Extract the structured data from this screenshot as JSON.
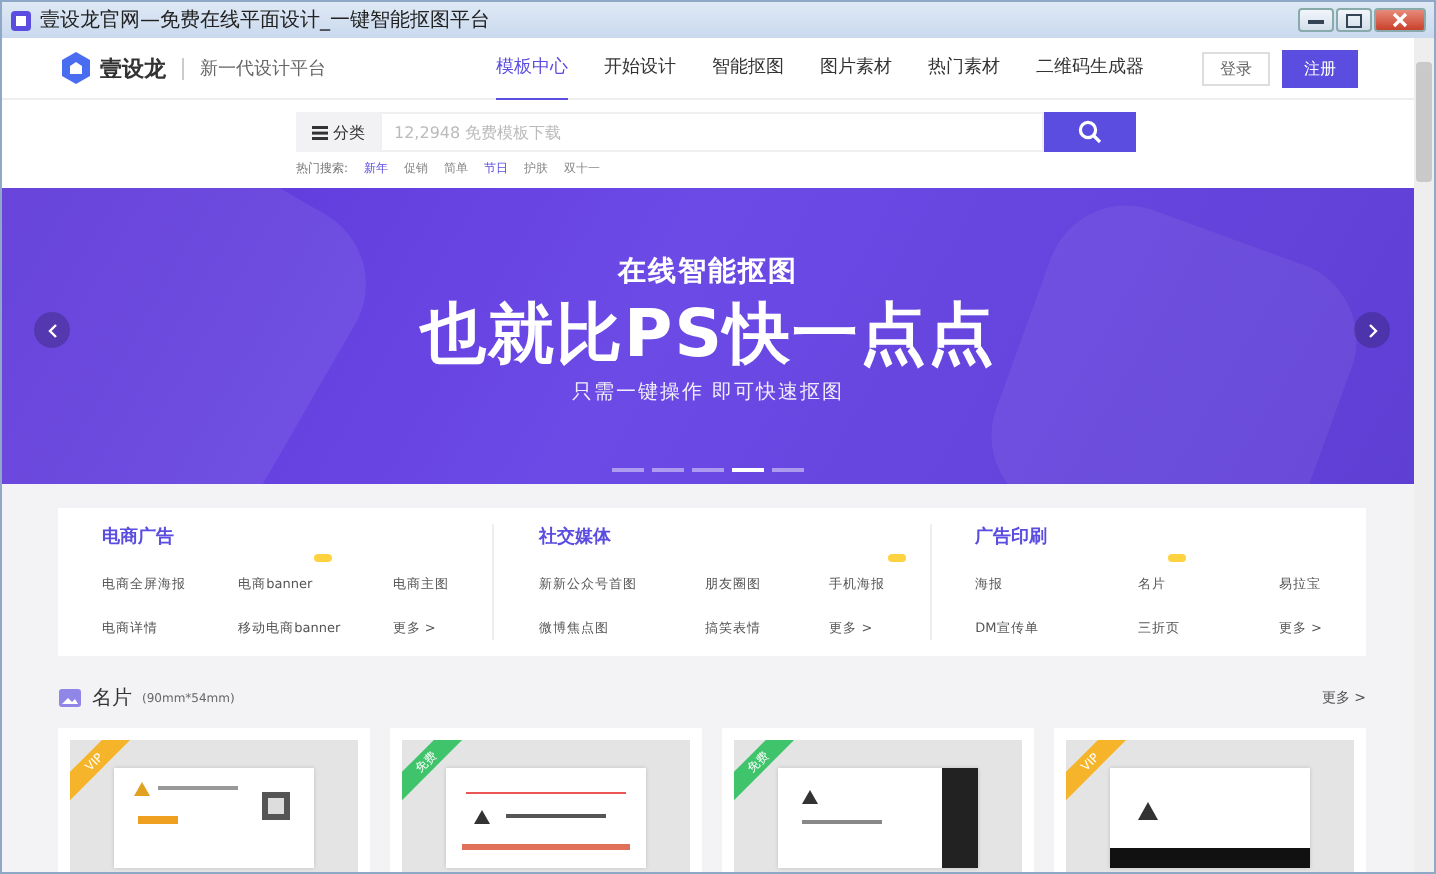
{
  "window": {
    "title": "壹设龙官网—免费在线平面设计_一键智能抠图平台"
  },
  "header": {
    "logo_text": "壹设龙",
    "slogan": "新一代设计平台",
    "nav": [
      {
        "label": "模板中心",
        "selected": true
      },
      {
        "label": "开始设计",
        "selected": false
      },
      {
        "label": "智能抠图",
        "selected": false
      },
      {
        "label": "图片素材",
        "selected": false
      },
      {
        "label": "热门素材",
        "selected": false
      },
      {
        "label": "二维码生成器",
        "selected": false
      }
    ],
    "login": "登录",
    "register": "注册"
  },
  "search": {
    "category": "分类",
    "placeholder": "12,2948 免费模板下载",
    "hot_label": "热门搜索:",
    "hot": [
      {
        "label": "新年",
        "highlighted": true
      },
      {
        "label": "促销",
        "highlighted": false
      },
      {
        "label": "简单",
        "highlighted": false
      },
      {
        "label": "节日",
        "highlighted": true
      },
      {
        "label": "护肤",
        "highlighted": false
      },
      {
        "label": "双十一",
        "highlighted": false
      }
    ]
  },
  "banner": {
    "kicker": "在线智能抠图",
    "headline": "也就比PS快一点点",
    "subline": "只需一键操作 即可快速抠图",
    "dots": [
      {
        "selected": false
      },
      {
        "selected": false
      },
      {
        "selected": false
      },
      {
        "selected": true
      },
      {
        "selected": false
      }
    ]
  },
  "categories": [
    {
      "title": "电商广告",
      "links": [
        {
          "label": "电商全屏海报",
          "hot": false
        },
        {
          "label": "电商banner",
          "hot": true
        },
        {
          "label": "电商主图",
          "hot": false
        },
        {
          "label": "电商详情",
          "hot": false
        },
        {
          "label": "移动电商banner",
          "hot": false
        },
        {
          "label": "更多 >",
          "hot": false
        }
      ]
    },
    {
      "title": "社交媒体",
      "links": [
        {
          "label": "新新公众号首图",
          "hot": false
        },
        {
          "label": "朋友圈图",
          "hot": false
        },
        {
          "label": "手机海报",
          "hot": true
        },
        {
          "label": "微博焦点图",
          "hot": false
        },
        {
          "label": "搞笑表情",
          "hot": false
        },
        {
          "label": "更多 >",
          "hot": false
        }
      ]
    },
    {
      "title": "广告印刷",
      "links": [
        {
          "label": "海报",
          "hot": false
        },
        {
          "label": "名片",
          "hot": true
        },
        {
          "label": "易拉宝",
          "hot": false
        },
        {
          "label": "DM宣传单",
          "hot": false
        },
        {
          "label": "三折页",
          "hot": false
        },
        {
          "label": "更多 >",
          "hot": false
        }
      ]
    }
  ],
  "section": {
    "title": "名片",
    "size": "(90mm*54mm)",
    "more": "更多 >",
    "cards": [
      {
        "ribbon": "VIP",
        "kind": "vip"
      },
      {
        "ribbon": "免费",
        "kind": "free"
      },
      {
        "ribbon": "免费",
        "kind": "free"
      },
      {
        "ribbon": "VIP",
        "kind": "vip"
      }
    ]
  }
}
